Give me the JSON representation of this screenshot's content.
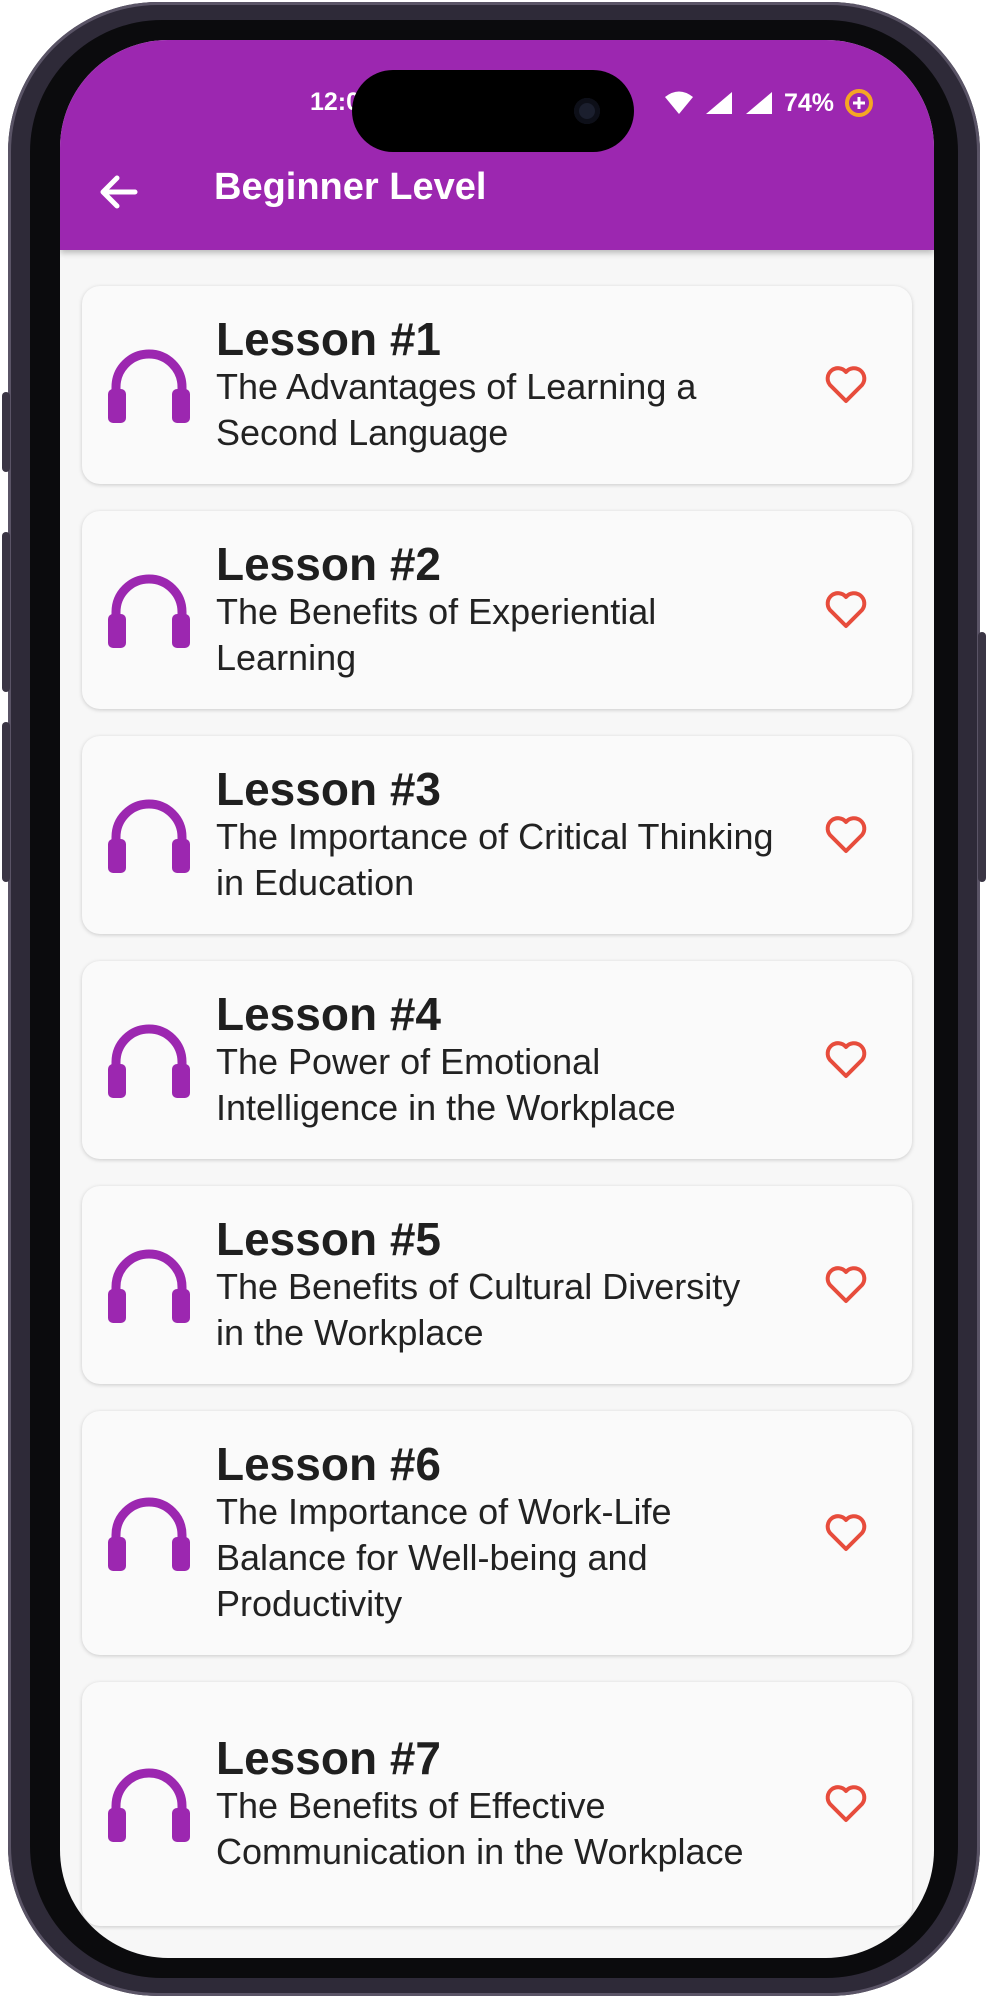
{
  "status": {
    "time": "12:0",
    "battery": "74%"
  },
  "appbar": {
    "title": "Beginner Level"
  },
  "colors": {
    "primary": "#9c27b0",
    "heart": "#e74c3c",
    "headphones": "#9c27b0"
  },
  "icons": {
    "back": "arrow-left-icon",
    "lesson": "headphones-icon",
    "favorite": "heart-outline-icon"
  },
  "lessons": [
    {
      "title": "Lesson #1",
      "subtitle": "The Advantages of Learning a Second Language"
    },
    {
      "title": "Lesson #2",
      "subtitle": "The Benefits of Experiential Learning"
    },
    {
      "title": "Lesson #3",
      "subtitle": "The Importance of Critical Thinking in Education"
    },
    {
      "title": "Lesson #4",
      "subtitle": "The Power of Emotional Intelligence in the Workplace"
    },
    {
      "title": "Lesson #5",
      "subtitle": "The Benefits of Cultural Diversity in the Workplace"
    },
    {
      "title": "Lesson #6",
      "subtitle": "The Importance of Work-Life Balance for Well-being and Productivity"
    },
    {
      "title": "Lesson #7",
      "subtitle": "The Benefits of Effective Communication in the Workplace"
    }
  ]
}
